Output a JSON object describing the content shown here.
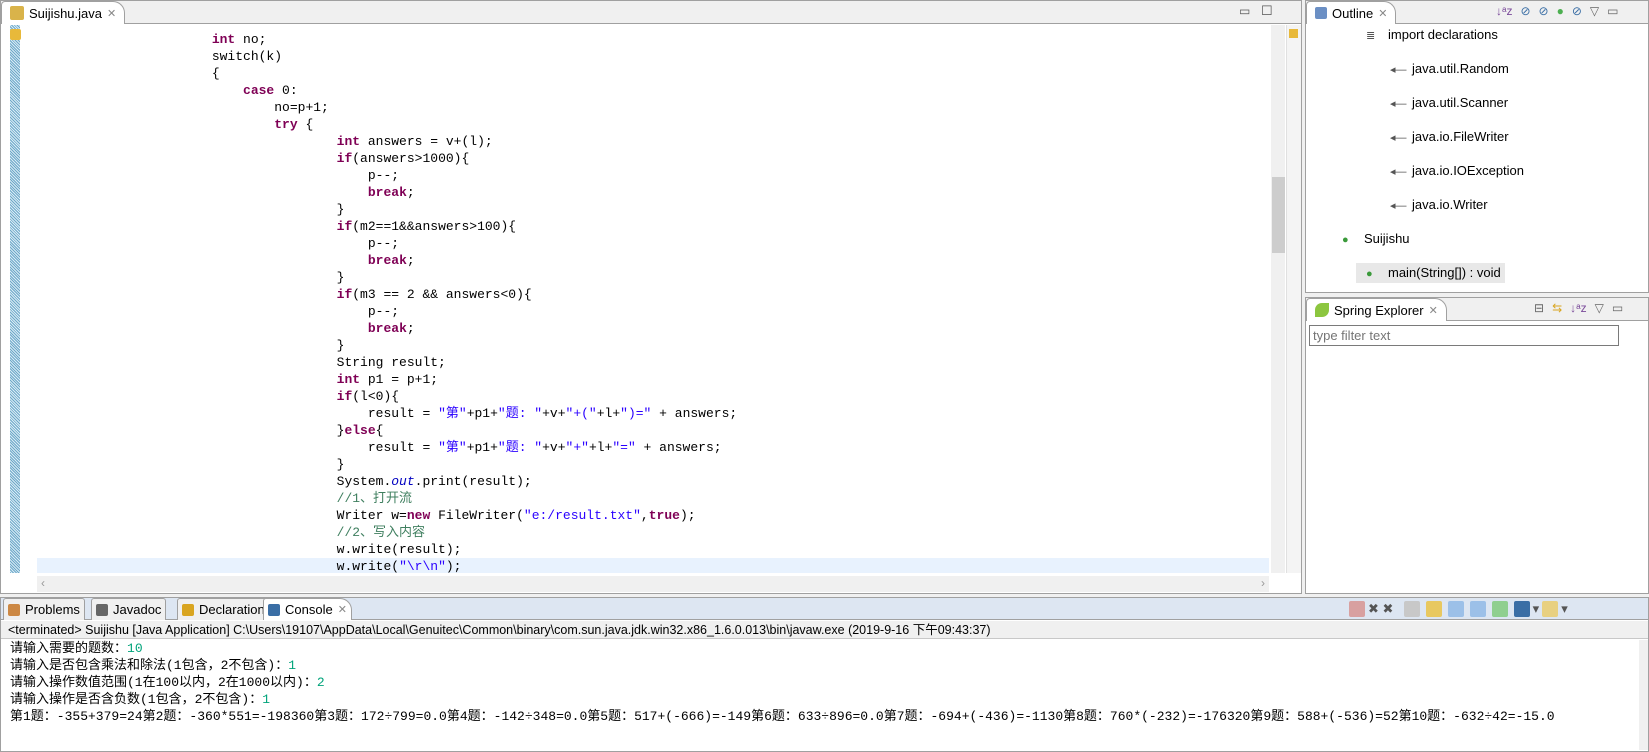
{
  "editor": {
    "tab_label": "Suijishu.java",
    "lines": [
      [
        [
          "",
          "\t\t\t\t"
        ],
        [
          "kw",
          "int"
        ],
        [
          "",
          " no;"
        ]
      ],
      [
        [
          "",
          "\t\t\t\tswitch(k)"
        ]
      ],
      [
        [
          "",
          "\t\t\t\t{"
        ]
      ],
      [
        [
          "",
          "\t\t\t\t\t"
        ],
        [
          "kw",
          "case"
        ],
        [
          "",
          " 0:"
        ]
      ],
      [
        [
          "",
          "\t\t\t\t\t\tno=p+1;"
        ]
      ],
      [
        [
          "",
          "\t\t\t\t\t\t"
        ],
        [
          "kw",
          "try"
        ],
        [
          "",
          " {"
        ]
      ],
      [
        [
          "",
          "\t\t\t\t\t\t\t\t"
        ],
        [
          "kw",
          "int"
        ],
        [
          "",
          " answers = v+(l);"
        ]
      ],
      [
        [
          "",
          "\t\t\t\t\t\t\t\t"
        ],
        [
          "kw",
          "if"
        ],
        [
          "",
          "(answers>1000){"
        ]
      ],
      [
        [
          "",
          "\t\t\t\t\t\t\t\t\tp--;"
        ]
      ],
      [
        [
          "",
          "\t\t\t\t\t\t\t\t\t"
        ],
        [
          "kw",
          "break"
        ],
        [
          "",
          ";"
        ]
      ],
      [
        [
          "",
          "\t\t\t\t\t\t\t\t}"
        ]
      ],
      [
        [
          "",
          "\t\t\t\t\t\t\t\t"
        ],
        [
          "kw",
          "if"
        ],
        [
          "",
          "(m2==1&&answers>100){"
        ]
      ],
      [
        [
          "",
          "\t\t\t\t\t\t\t\t\tp--;"
        ]
      ],
      [
        [
          "",
          "\t\t\t\t\t\t\t\t\t"
        ],
        [
          "kw",
          "break"
        ],
        [
          "",
          ";"
        ]
      ],
      [
        [
          "",
          "\t\t\t\t\t\t\t\t}"
        ]
      ],
      [
        [
          "",
          "\t\t\t\t\t\t\t\t"
        ],
        [
          "kw",
          "if"
        ],
        [
          "",
          "(m3 == 2 && answers<0){"
        ]
      ],
      [
        [
          "",
          "\t\t\t\t\t\t\t\t\tp--;"
        ]
      ],
      [
        [
          "",
          "\t\t\t\t\t\t\t\t\t"
        ],
        [
          "kw",
          "break"
        ],
        [
          "",
          ";"
        ]
      ],
      [
        [
          "",
          "\t\t\t\t\t\t\t\t}"
        ]
      ],
      [
        [
          "",
          "\t\t\t\t\t\t\t\tString result;"
        ]
      ],
      [
        [
          "",
          "\t\t\t\t\t\t\t\t"
        ],
        [
          "kw",
          "int"
        ],
        [
          "",
          " p1 = p+1;"
        ]
      ],
      [
        [
          "",
          "\t\t\t\t\t\t\t\t"
        ],
        [
          "kw",
          "if"
        ],
        [
          "",
          "(l<0){"
        ]
      ],
      [
        [
          "",
          "\t\t\t\t\t\t\t\t\tresult = "
        ],
        [
          "str",
          "\"第\""
        ],
        [
          "",
          "+p1+"
        ],
        [
          "str",
          "\"题: \""
        ],
        [
          "",
          "+v+"
        ],
        [
          "str",
          "\"+(\""
        ],
        [
          "",
          "+l+"
        ],
        [
          "str",
          "\")=\""
        ],
        [
          "",
          " + answers;"
        ]
      ],
      [
        [
          "",
          "\t\t\t\t\t\t\t\t}"
        ],
        [
          "kw",
          "else"
        ],
        [
          "",
          "{"
        ]
      ],
      [
        [
          "",
          "\t\t\t\t\t\t\t\t\tresult = "
        ],
        [
          "str",
          "\"第\""
        ],
        [
          "",
          "+p1+"
        ],
        [
          "str",
          "\"题: \""
        ],
        [
          "",
          "+v+"
        ],
        [
          "str",
          "\"+\""
        ],
        [
          "",
          "+l+"
        ],
        [
          "str",
          "\"=\""
        ],
        [
          "",
          " + answers;"
        ]
      ],
      [
        [
          "",
          "\t\t\t\t\t\t\t\t}"
        ]
      ],
      [
        [
          "",
          "\t\t\t\t\t\t\t\tSystem."
        ],
        [
          "fld",
          "out"
        ],
        [
          "",
          ".print(result);"
        ]
      ],
      [
        [
          "",
          "\t\t\t\t\t\t\t\t"
        ],
        [
          "cm",
          "//1、打开流"
        ]
      ],
      [
        [
          "",
          "\t\t\t\t\t\t\t\tWriter w="
        ],
        [
          "kw",
          "new"
        ],
        [
          "",
          " FileWriter("
        ],
        [
          "str",
          "\"e:/result.txt\""
        ],
        [
          "",
          ","
        ],
        [
          "kw",
          "true"
        ],
        [
          "",
          ");"
        ]
      ],
      [
        [
          "",
          "\t\t\t\t\t\t\t\t"
        ],
        [
          "cm",
          "//2、写入内容"
        ]
      ],
      [
        [
          "",
          "\t\t\t\t\t\t\t\tw.write(result);"
        ]
      ],
      [
        [
          "",
          "\t\t\t\t\t\t\t\tw.write("
        ],
        [
          "str",
          "\"\\r\\n\""
        ],
        [
          "",
          ");"
        ]
      ]
    ]
  },
  "outline": {
    "tab_label": "Outline",
    "items": [
      {
        "label": "import declarations",
        "icon": "imports-icon"
      },
      {
        "label": "java.util.Random",
        "icon": "import-icon"
      },
      {
        "label": "java.util.Scanner",
        "icon": "import-icon"
      },
      {
        "label": "java.io.FileWriter",
        "icon": "import-icon"
      },
      {
        "label": "java.io.IOException",
        "icon": "import-icon"
      },
      {
        "label": "java.io.Writer",
        "icon": "import-icon"
      },
      {
        "label": "Suijishu",
        "icon": "class-icon"
      },
      {
        "label": "main(String[]) : void",
        "icon": "method-icon"
      }
    ]
  },
  "spring": {
    "tab_label": "Spring Explorer",
    "filter_placeholder": "type filter text"
  },
  "bottom": {
    "tabs": [
      {
        "label": "Problems"
      },
      {
        "label": "Javadoc"
      },
      {
        "label": "Declaration"
      },
      {
        "label": "Console"
      }
    ],
    "status": "<terminated> Suijishu [Java Application] C:\\Users\\19107\\AppData\\Local\\Genuitec\\Common\\binary\\com.sun.java.jdk.win32.x86_1.6.0.013\\bin\\javaw.exe (2019-9-16 下午09:43:37)",
    "console": [
      {
        "prompt": "请输入需要的题数：",
        "input": "10"
      },
      {
        "prompt": "请输入是否包含乘法和除法(1包含，2不包含)：",
        "input": "1"
      },
      {
        "prompt": "请输入操作数值范围(1在100以内，2在1000以内)：",
        "input": "2"
      },
      {
        "prompt": "请输入操作是否含负数(1包含，2不包含)：",
        "input": "1"
      },
      {
        "prompt": "第1题：-355+379=24第2题：-360*551=-198360第3题：172÷799=0.0第4题：-142÷348=0.0第5题：517+(-666)=-149第6题：633÷896=0.0第7题：-694+(-436)=-1130第8题：760*(-232)=-176320第9题：588+(-536)=52第10题：-632÷42=-15.0",
        "input": ""
      }
    ]
  },
  "colors": {
    "keyword": "#7f0055",
    "string": "#2a00ff",
    "comment": "#3f7f5f",
    "field": "#0000c0",
    "console_input": "#00a37a",
    "current_line": "#e8f2fe"
  }
}
